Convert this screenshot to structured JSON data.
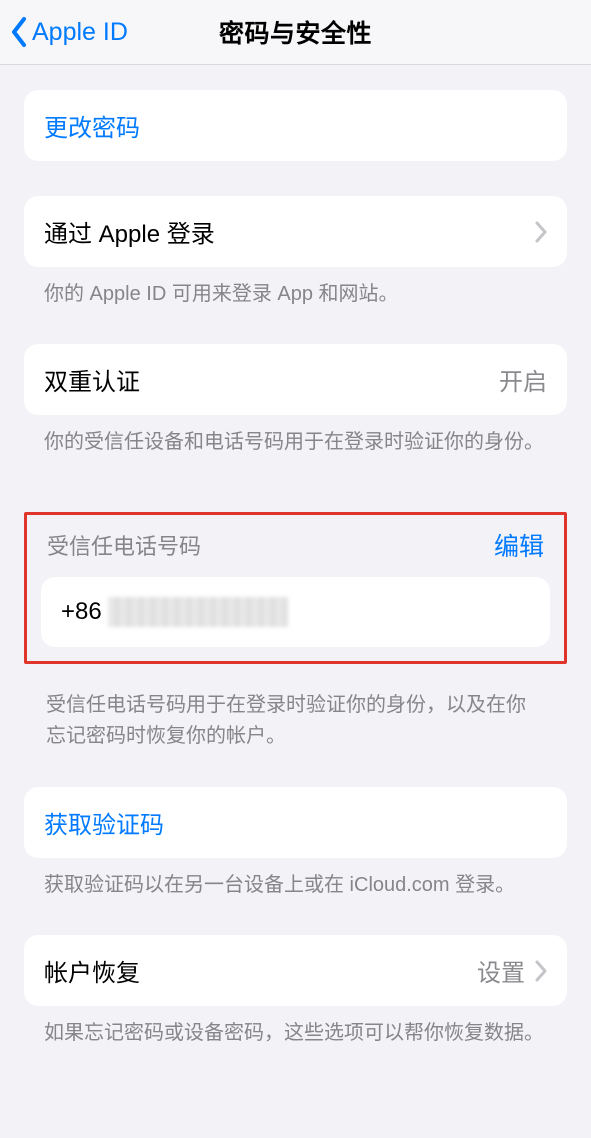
{
  "header": {
    "back_label": "Apple ID",
    "title": "密码与安全性"
  },
  "change_password": {
    "label": "更改密码"
  },
  "sign_in_with_apple": {
    "label": "通过 Apple 登录",
    "footer": "你的 Apple ID 可用来登录 App 和网站。"
  },
  "two_factor": {
    "label": "双重认证",
    "value": "开启",
    "footer": "你的受信任设备和电话号码用于在登录时验证你的身份。"
  },
  "trusted_phone": {
    "header": "受信任电话号码",
    "edit": "编辑",
    "prefix": "+86",
    "footer": "受信任电话号码用于在登录时验证你的身份，以及在你忘记密码时恢复你的帐户。"
  },
  "get_code": {
    "label": "获取验证码",
    "footer": "获取验证码以在另一台设备上或在 iCloud.com 登录。"
  },
  "account_recovery": {
    "label": "帐户恢复",
    "value": "设置",
    "footer": "如果忘记密码或设备密码，这些选项可以帮你恢复数据。"
  }
}
